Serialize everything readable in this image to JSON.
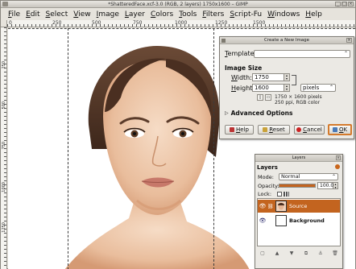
{
  "window": {
    "title": "*ShatteredFace.xcf-3.0 (RGB, 2 layers) 1750x1600 – GIMP",
    "controls": [
      "_",
      "□",
      "×"
    ]
  },
  "menubar": [
    "File",
    "Edit",
    "Select",
    "View",
    "Image",
    "Layer",
    "Colors",
    "Tools",
    "Filters",
    "Script-Fu",
    "Windows",
    "Help"
  ],
  "ruler": {
    "h_ticks": [
      "0",
      "250",
      "500",
      "750",
      "1000",
      "1250",
      "1500"
    ],
    "v_ticks": [
      "250",
      "500",
      "750",
      "1000",
      "1250"
    ]
  },
  "new_image_dialog": {
    "title": "Create a New Image",
    "template_label": "Template:",
    "template_value": "",
    "section_title": "Image Size",
    "width_label": "Width:",
    "width_value": "1750",
    "height_label": "Height:",
    "height_value": "1600",
    "unit": "pixels",
    "info_line1": "1750 × 1600 pixels",
    "info_line2": "250 ppi, RGB color",
    "advanced_label": "Advanced Options",
    "buttons": {
      "help": "Help",
      "reset": "Reset",
      "cancel": "Cancel",
      "ok": "OK"
    }
  },
  "layers_dock": {
    "title": "Layers",
    "panel_title": "Layers",
    "mode_label": "Mode:",
    "mode_value": "Normal",
    "opacity_label": "Opacity:",
    "opacity_value": "100.0",
    "opacity_fraction": 1.0,
    "lock_label": "Lock:",
    "layers": [
      {
        "name": "Source",
        "selected": true
      },
      {
        "name": "Background",
        "selected": false
      }
    ]
  },
  "colors": {
    "accent": "#c3641f",
    "canvas": "#ffffff",
    "chrome": "#e6e3dc"
  },
  "icons": [
    "window-menu-icon",
    "minimize-icon",
    "maximize-icon",
    "close-icon",
    "chain-link-icon",
    "help-icon",
    "reset-icon",
    "cancel-icon",
    "ok-icon",
    "eye-icon",
    "chain-icon",
    "layer-new-icon",
    "layer-raise-icon",
    "layer-lower-icon",
    "layer-duplicate-icon",
    "layer-anchor-icon",
    "layer-delete-icon"
  ]
}
